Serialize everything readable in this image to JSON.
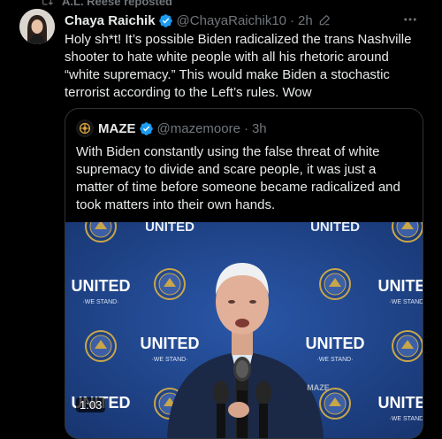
{
  "repost": {
    "label": "A.L. Reese reposted"
  },
  "tweet": {
    "name": "Chaya Raichik",
    "handle": "@ChayaRaichik10",
    "separator": "·",
    "time": "2h",
    "text": "Holy sh*t! It’s possible Biden radicalized the trans Nashville shooter to hate white people with all his rhetoric around “white supremacy.” This would make Biden a stochastic terrorist according to the Left’s rules. Wow"
  },
  "quote": {
    "name": "MAZE",
    "handle": "@mazemoore",
    "separator": "·",
    "time": "3h",
    "text": "With Biden constantly using the false threat of white supremacy to divide and scare people, it was just a matter of time before someone became radicalized and took matters into their own hands.",
    "video": {
      "timestamp": "1:03",
      "backdrop_top_word": "UNITED",
      "backdrop_word": "UNITED",
      "backdrop_sub": "·WE STAND·",
      "lectern_text": "MAZE"
    }
  },
  "colors": {
    "verified": "#1d9bf0",
    "muted": "#71767b",
    "backdrop": "#1d3f82"
  },
  "icons": [
    "repost-icon",
    "verified-badge-icon",
    "edit-pencil-icon",
    "more-icon",
    "maze-logo"
  ]
}
